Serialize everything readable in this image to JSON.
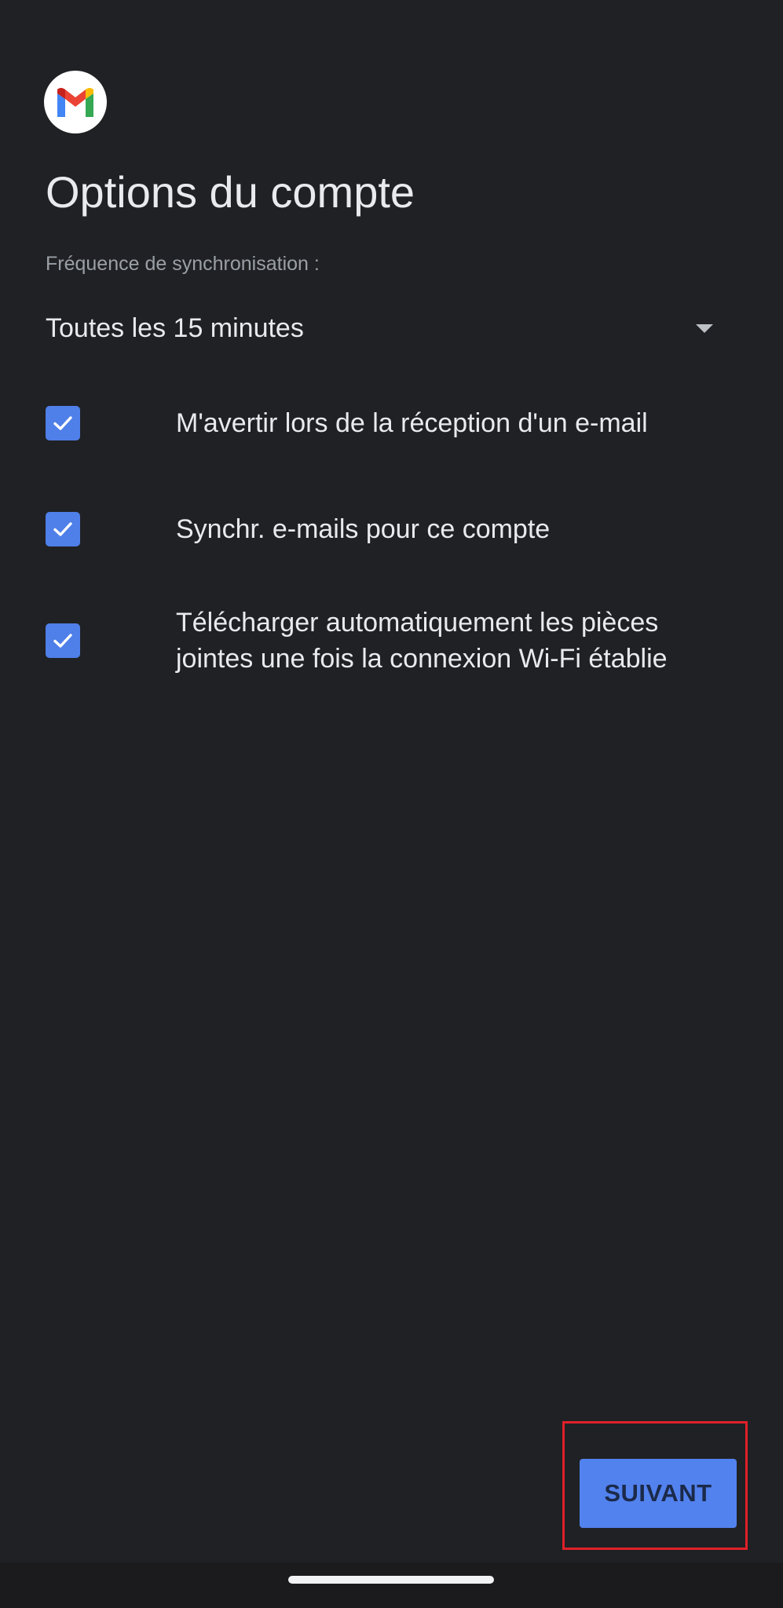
{
  "logo": {
    "icon": "gmail-logo-icon",
    "colors": {
      "red": "#EA4335",
      "blue": "#4285F4",
      "green": "#34A853",
      "yellow": "#FBBC05",
      "darkred": "#C5221F"
    }
  },
  "title": "Options du compte",
  "sync": {
    "label": "Fréquence de synchronisation :",
    "selected": "Toutes les 15 minutes",
    "icon": "dropdown-caret-icon"
  },
  "options": [
    {
      "label": "M'avertir lors de la réception d'un e-mail",
      "checked": true
    },
    {
      "label": "Synchr. e-mails pour ce compte",
      "checked": true
    },
    {
      "label": "Télécharger automatiquement les pièces jointes une fois la connexion Wi-Fi établie",
      "checked": true
    }
  ],
  "next_button": {
    "label": "SUIVANT",
    "color": "#5282ee",
    "highlight_color": "#e0202a"
  },
  "colors": {
    "background": "#202124",
    "checkbox": "#4f7fe8"
  }
}
